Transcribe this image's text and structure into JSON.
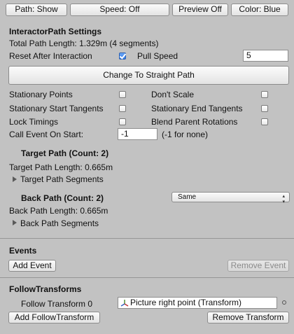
{
  "toolbar": {
    "path_button": "Path: Show",
    "speed_button": "Speed: Off",
    "preview_button": "Preview Off",
    "color_button": "Color: Blue"
  },
  "settings": {
    "header": "InteractorPath Settings",
    "total_length": "Total Path Length: 1.329m (4 segments)",
    "reset_after_interaction": "Reset After Interaction",
    "reset_checked": true,
    "pull_speed_label": "Pull Speed",
    "pull_speed_value": "5",
    "straight_path_button": "Change To Straight Path",
    "stationary_points": "Stationary Points",
    "dont_scale": "Don't Scale",
    "stationary_start_tangents": "Stationary Start Tangents",
    "stationary_end_tangents": "Stationary End Tangents",
    "lock_timings": "Lock Timings",
    "blend_parent_rotations": "Blend Parent Rotations",
    "call_event_label": "Call Event On Start:",
    "call_event_value": "-1",
    "call_event_hint": "(-1 for none)"
  },
  "target_path": {
    "header": "Target Path (Count: 2)",
    "length": "Target Path Length: 0.665m",
    "segments": "Target Path Segments"
  },
  "back_path": {
    "header": "Back Path (Count: 2)",
    "mode": "Same",
    "length": "Back Path Length: 0.665m",
    "segments": "Back Path Segments"
  },
  "events": {
    "header": "Events",
    "add_button": "Add Event",
    "remove_button": "Remove Event"
  },
  "follow": {
    "header": "FollowTransforms",
    "item_label": "Follow Transform 0",
    "item_value": "Picture right point (Transform)",
    "add_button": "Add FollowTransform",
    "remove_button": "Remove Transform"
  }
}
